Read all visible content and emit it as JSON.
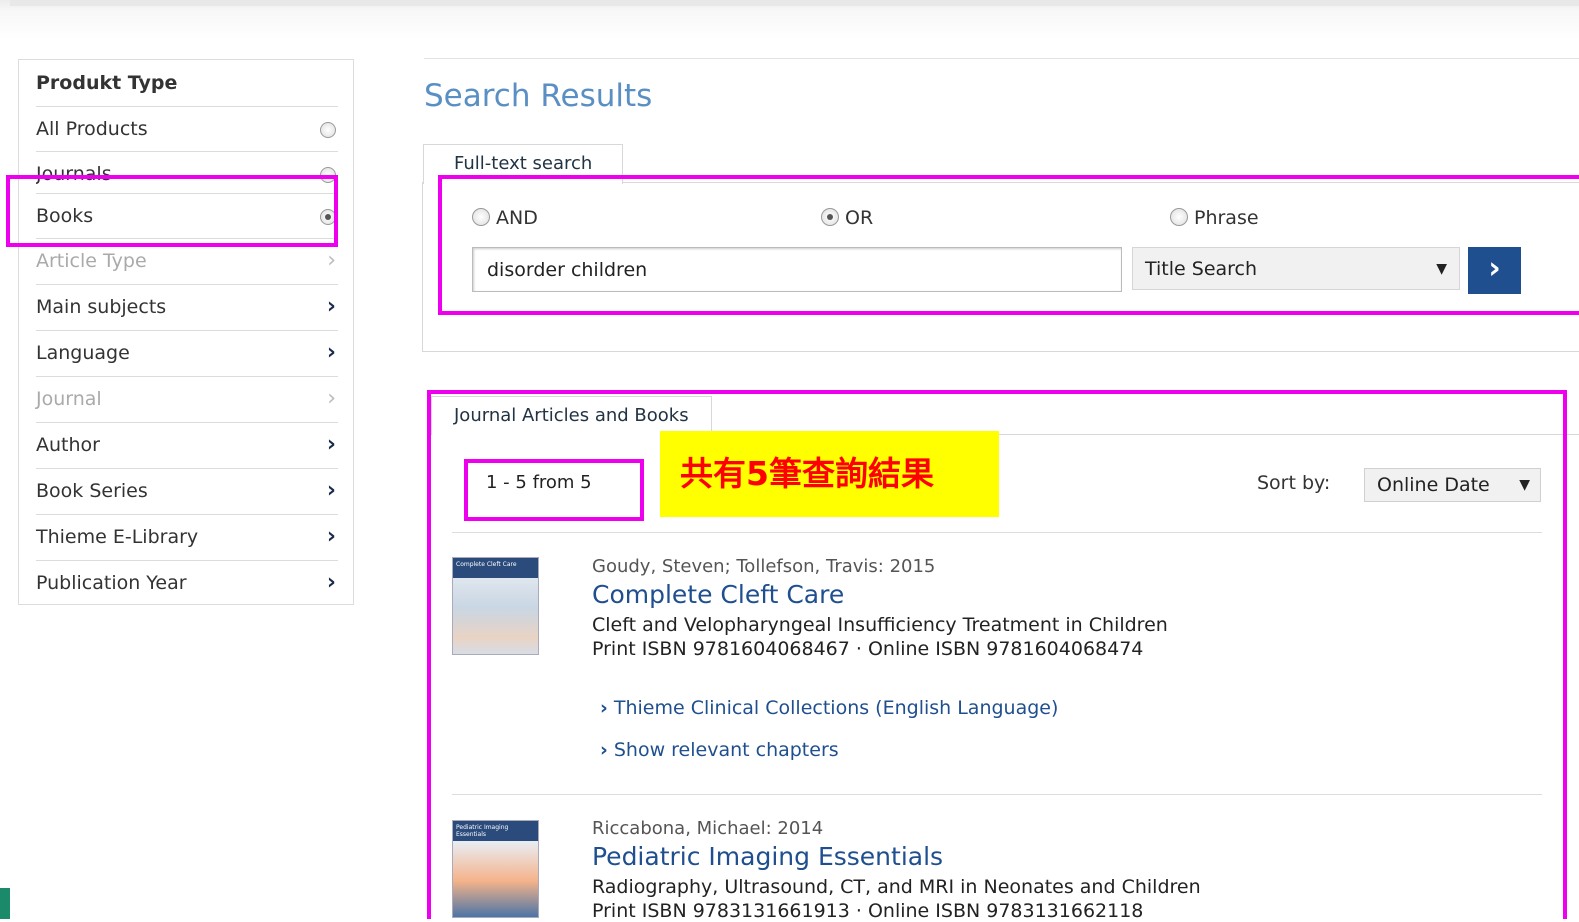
{
  "sidebar": {
    "title": "Produkt Type",
    "items": [
      {
        "label": "All Products",
        "control": "radio",
        "selected": false,
        "enabled": true
      },
      {
        "label": "Journals",
        "control": "radio",
        "selected": false,
        "enabled": true
      },
      {
        "label": "Books",
        "control": "radio",
        "selected": true,
        "enabled": true
      },
      {
        "label": "Article Type",
        "control": "chevron",
        "enabled": false
      },
      {
        "label": "Main subjects",
        "control": "chevron",
        "enabled": true
      },
      {
        "label": "Language",
        "control": "chevron",
        "enabled": true
      },
      {
        "label": "Journal",
        "control": "chevron",
        "enabled": false
      },
      {
        "label": "Author",
        "control": "chevron",
        "enabled": true
      },
      {
        "label": "Book Series",
        "control": "chevron",
        "enabled": true
      },
      {
        "label": "Thieme E-Library",
        "control": "chevron",
        "enabled": true
      },
      {
        "label": "Publication Year",
        "control": "chevron",
        "enabled": true
      }
    ]
  },
  "main": {
    "title": "Search Results",
    "search": {
      "tab_label": "Full-text search",
      "options": [
        {
          "label": "AND",
          "selected": false
        },
        {
          "label": "OR",
          "selected": true
        },
        {
          "label": "Phrase",
          "selected": false
        }
      ],
      "query": "disorder children",
      "search_type": "Title Search",
      "go_label": "›"
    },
    "results": {
      "tab_label": "Journal Articles and Books",
      "count_text": "1 - 5 from 5",
      "annotation": "共有5筆查詢結果",
      "sort_label": "Sort by:",
      "sort_value": "Online Date",
      "items": [
        {
          "meta": "Goudy, Steven; Tollefson, Travis: 2015",
          "title": "Complete Cleft Care",
          "subtitle": "Cleft and Velopharyngeal Insufficiency Treatment in Children",
          "isbn": "Print ISBN 9781604068467 · Online ISBN 9781604068474",
          "cover_text": "Complete Cleft Care",
          "links": [
            "Thieme Clinical Collections (English Language)",
            "Show relevant chapters"
          ]
        },
        {
          "meta": "Riccabona, Michael: 2014",
          "title": "Pediatric Imaging Essentials",
          "subtitle": "Radiography, Ultrasound, CT, and MRI in Neonates and Children",
          "isbn": "Print ISBN 9783131661913 · Online ISBN 9783131662118",
          "cover_text": "Pediatric Imaging Essentials"
        }
      ]
    }
  },
  "colors": {
    "highlight_border": "#ee00ee",
    "annotation_bg": "#ffff00",
    "annotation_text": "#ff0000",
    "link": "#1f4f8f",
    "title": "#5a8fc4"
  }
}
